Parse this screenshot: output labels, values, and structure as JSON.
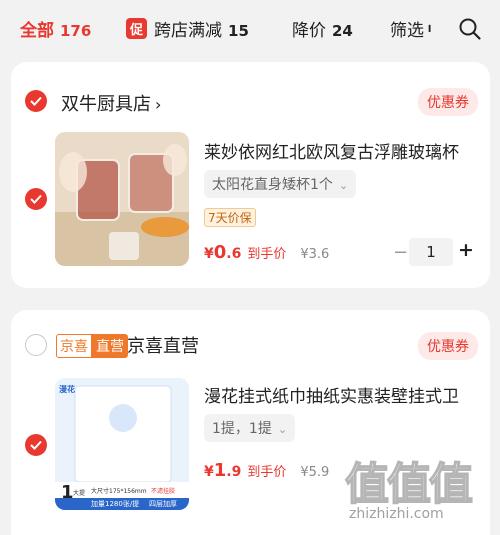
{
  "tabs": {
    "all": {
      "label": "全部",
      "count": "176"
    },
    "promo": {
      "badge": "促",
      "label": "跨店满减",
      "count": "15"
    },
    "price_drop": {
      "label": "降价",
      "count": "24"
    },
    "filter": {
      "label": "筛选",
      "mark": "╹"
    }
  },
  "shop1": {
    "name": "双牛厨具店",
    "chevron": "›",
    "coupon": "优惠券",
    "item": {
      "title": "莱妙依网红北欧风复古浮雕玻璃杯",
      "spec": "太阳花直身矮杯1个",
      "spec_chevron": "⌄",
      "tag": "7天价保",
      "price_currency": "¥",
      "price_int": "0",
      "price_dec": ".6",
      "price_suffix": "到手价",
      "original_price": "¥3.6",
      "qty_minus": "−",
      "qty": "1",
      "qty_plus": "+"
    }
  },
  "shop2": {
    "badge_left": "京喜",
    "badge_right": "直营",
    "name": "京喜直营",
    "coupon": "优惠券",
    "item": {
      "title": "漫花挂式纸巾抽纸实惠装壁挂式卫",
      "spec": "1提，1提",
      "spec_chevron": "⌄",
      "price_currency": "¥",
      "price_int": "1",
      "price_dec": ".9",
      "price_suffix": "到手价",
      "original_price": "¥5.9",
      "thumb_top": "漫花",
      "thumb_size": "大尺寸175*156mm",
      "thumb_tag": "不滤挂胶",
      "thumb_count": "1",
      "thumb_unit": "大提",
      "thumb_bottom": "加量1280张/提",
      "thumb_bottom2": "四层加厚"
    }
  },
  "watermark": {
    "glyphs": "值值值",
    "url": "zhizhizhi.com"
  }
}
